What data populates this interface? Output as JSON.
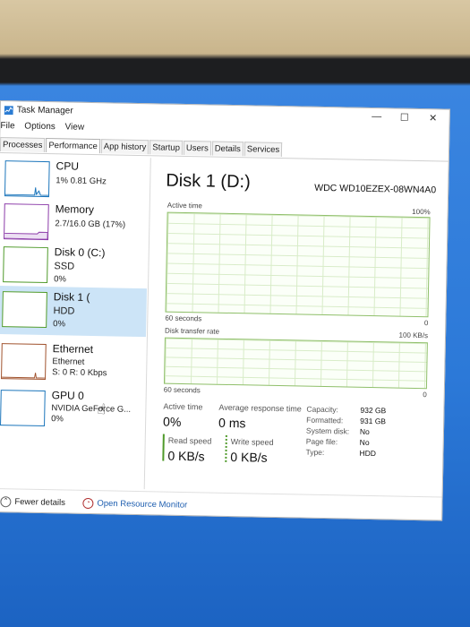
{
  "window": {
    "title": "Task Manager",
    "minimize": "—",
    "maximize": "☐",
    "close": "✕"
  },
  "menu": [
    "File",
    "Options",
    "View"
  ],
  "tabs": [
    "Processes",
    "Performance",
    "App history",
    "Startup",
    "Users",
    "Details",
    "Services"
  ],
  "sidebar": {
    "items": [
      {
        "name": "CPU",
        "sub1": "1% 0.81 GHz",
        "sub2": "",
        "sub3": "",
        "color": "#1b75bb"
      },
      {
        "name": "Memory",
        "sub1": "2.7/16.0 GB (17%)",
        "sub2": "",
        "sub3": "",
        "color": "#8b3aa8"
      },
      {
        "name": "Disk 0 (C:)",
        "sub1": "SSD",
        "sub2": "0%",
        "sub3": "",
        "color": "#4f9a2a"
      },
      {
        "name": "Disk 1 (",
        "sub1": "HDD",
        "sub2": "0%",
        "sub3": "",
        "color": "#4f9a2a"
      },
      {
        "name": "Ethernet",
        "sub1": "Ethernet",
        "sub2": "S: 0 R: 0 Kbps",
        "sub3": "",
        "color": "#a0522d"
      },
      {
        "name": "GPU 0",
        "sub1": "NVIDIA GeForce G...",
        "sub2": "0%",
        "sub3": "",
        "color": "#1b75bb"
      }
    ]
  },
  "main": {
    "title": "Disk 1 (D:)",
    "model": "WDC WD10EZEX-08WN4A0",
    "graph1": {
      "label": "Active time",
      "max": "100%",
      "span": "60 seconds",
      "min": "0"
    },
    "graph2": {
      "label": "Disk transfer rate",
      "max": "100 KB/s",
      "span": "60 seconds",
      "min": "0"
    },
    "stats": {
      "active_time_label": "Active time",
      "active_time": "0%",
      "avg_resp_label": "Average response time",
      "avg_resp": "0 ms",
      "read_label": "Read speed",
      "read": "0 KB/s",
      "write_label": "Write speed",
      "write": "0 KB/s"
    },
    "properties": [
      {
        "k": "Capacity:",
        "v": "932 GB"
      },
      {
        "k": "Formatted:",
        "v": "931 GB"
      },
      {
        "k": "System disk:",
        "v": "No"
      },
      {
        "k": "Page file:",
        "v": "No"
      },
      {
        "k": "Type:",
        "v": "HDD"
      }
    ]
  },
  "footer": {
    "fewer": "Fewer details",
    "resmon": "Open Resource Monitor"
  },
  "colors": {
    "disk_green": "#4f9a2a",
    "link_blue": "#1f5fb0",
    "selected_bg": "#cce4f7"
  }
}
